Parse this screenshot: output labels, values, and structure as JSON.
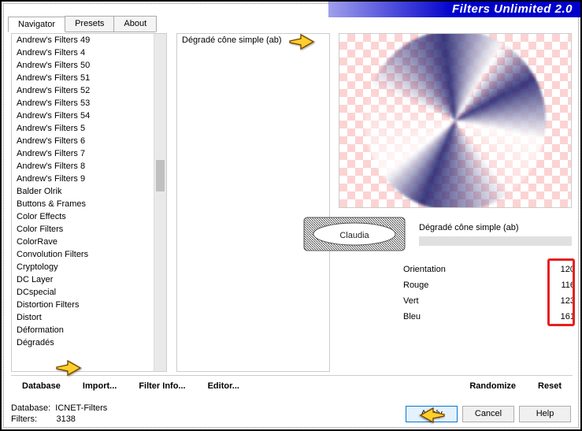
{
  "header": {
    "title": "Filters Unlimited 2.0"
  },
  "tabs": [
    "Navigator",
    "Presets",
    "About"
  ],
  "tabs_active": 0,
  "category_list": [
    "Andrew's Filters 49",
    "Andrew's Filters 4",
    "Andrew's Filters 50",
    "Andrew's Filters 51",
    "Andrew's Filters 52",
    "Andrew's Filters 53",
    "Andrew's Filters 54",
    "Andrew's Filters 5",
    "Andrew's Filters 6",
    "Andrew's Filters 7",
    "Andrew's Filters 8",
    "Andrew's Filters 9",
    "Balder Olrik",
    "Buttons & Frames",
    "Color Effects",
    "Color Filters",
    "ColorRave",
    "Convolution Filters",
    "Cryptology",
    "DC Layer",
    "DCspecial",
    "Distortion Filters",
    "Distort",
    "Déformation",
    "Dégradés"
  ],
  "category_selected": "Dégradés",
  "filter_list": [
    "Dégradé cône simple (ab)"
  ],
  "filter_selected": "Dégradé cône simple (ab)",
  "selected_filter_title": "Dégradé cône simple (ab)",
  "watermark_text": "Claudia",
  "params": [
    {
      "label": "Orientation",
      "value": 120
    },
    {
      "label": "Rouge",
      "value": 116
    },
    {
      "label": "Vert",
      "value": 123
    },
    {
      "label": "Bleu",
      "value": 161
    }
  ],
  "toolbar": {
    "database": "Database",
    "import": "Import...",
    "filter_info": "Filter Info...",
    "editor": "Editor...",
    "randomize": "Randomize",
    "reset": "Reset"
  },
  "footer": {
    "db_label": "Database:",
    "db_value": "ICNET-Filters",
    "filters_label": "Filters:",
    "filters_value": "3138"
  },
  "buttons": {
    "apply": "Apply",
    "cancel": "Cancel",
    "help": "Help"
  },
  "icons": {
    "pointer": "hand-pointer-icon"
  }
}
